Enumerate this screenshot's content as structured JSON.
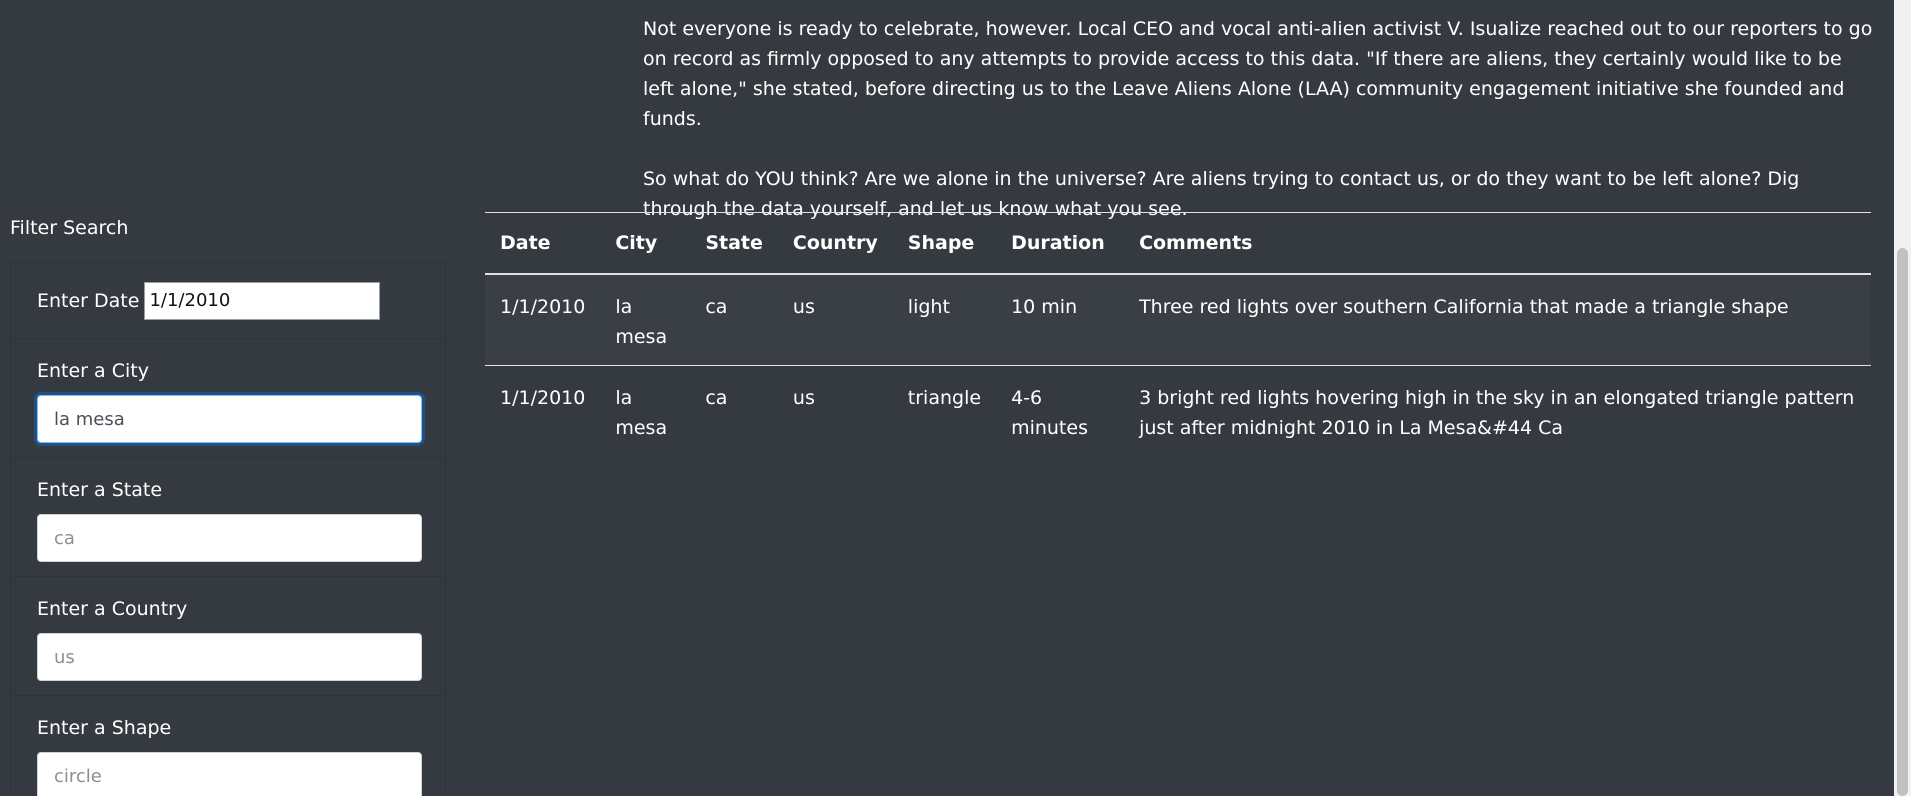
{
  "article": {
    "paragraph1": "Not everyone is ready to celebrate, however. Local CEO and vocal anti-alien activist V. Isualize reached out to our reporters to go on record as firmly opposed to any attempts to provide access to this data. \"If there are aliens, they certainly would like to be left alone,\" she stated, before directing us to the Leave Aliens Alone (LAA) community engagement initiative she founded and funds.",
    "paragraph2": "So what do YOU think? Are we alone in the universe? Are aliens trying to contact us, or do they want to be left alone? Dig through the data yourself, and let us know what you see."
  },
  "filters": {
    "title": "Filter Search",
    "date": {
      "label": "Enter Date",
      "value": "1/1/2010"
    },
    "city": {
      "label": "Enter a City",
      "value": "la mesa",
      "placeholder": ""
    },
    "state": {
      "label": "Enter a State",
      "value": "",
      "placeholder": "ca"
    },
    "country": {
      "label": "Enter a Country",
      "value": "",
      "placeholder": "us"
    },
    "shape": {
      "label": "Enter a Shape",
      "value": "",
      "placeholder": "circle"
    }
  },
  "table": {
    "headers": {
      "date": "Date",
      "city": "City",
      "state": "State",
      "country": "Country",
      "shape": "Shape",
      "duration": "Duration",
      "comments": "Comments"
    },
    "rows": [
      {
        "date": "1/1/2010",
        "city": "la mesa",
        "state": "ca",
        "country": "us",
        "shape": "light",
        "duration": "10 min",
        "comments": "Three red lights over southern California that made a triangle shape"
      },
      {
        "date": "1/1/2010",
        "city": "la mesa",
        "state": "ca",
        "country": "us",
        "shape": "triangle",
        "duration": "4-6 minutes",
        "comments": "3 bright red lights hovering high in the sky in an elongated triangle pattern just after midnight 2010 in La Mesa&#44 Ca"
      }
    ]
  }
}
